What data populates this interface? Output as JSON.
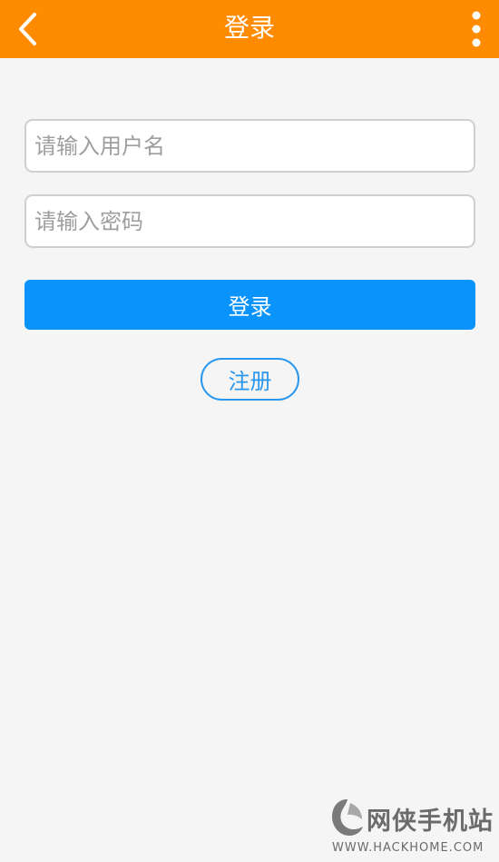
{
  "header": {
    "title": "登录",
    "back_icon": "chevron-left-icon",
    "more_icon": "more-vertical-icon",
    "background_color": "#ff8c00"
  },
  "form": {
    "username": {
      "value": "",
      "placeholder": "请输入用户名"
    },
    "password": {
      "value": "",
      "placeholder": "请输入密码"
    },
    "login_label": "登录",
    "register_label": "注册",
    "accent_color": "#0a93fb"
  },
  "watermark": {
    "name": "网侠手机站",
    "url": "WWW.HACKHOME.COM"
  }
}
